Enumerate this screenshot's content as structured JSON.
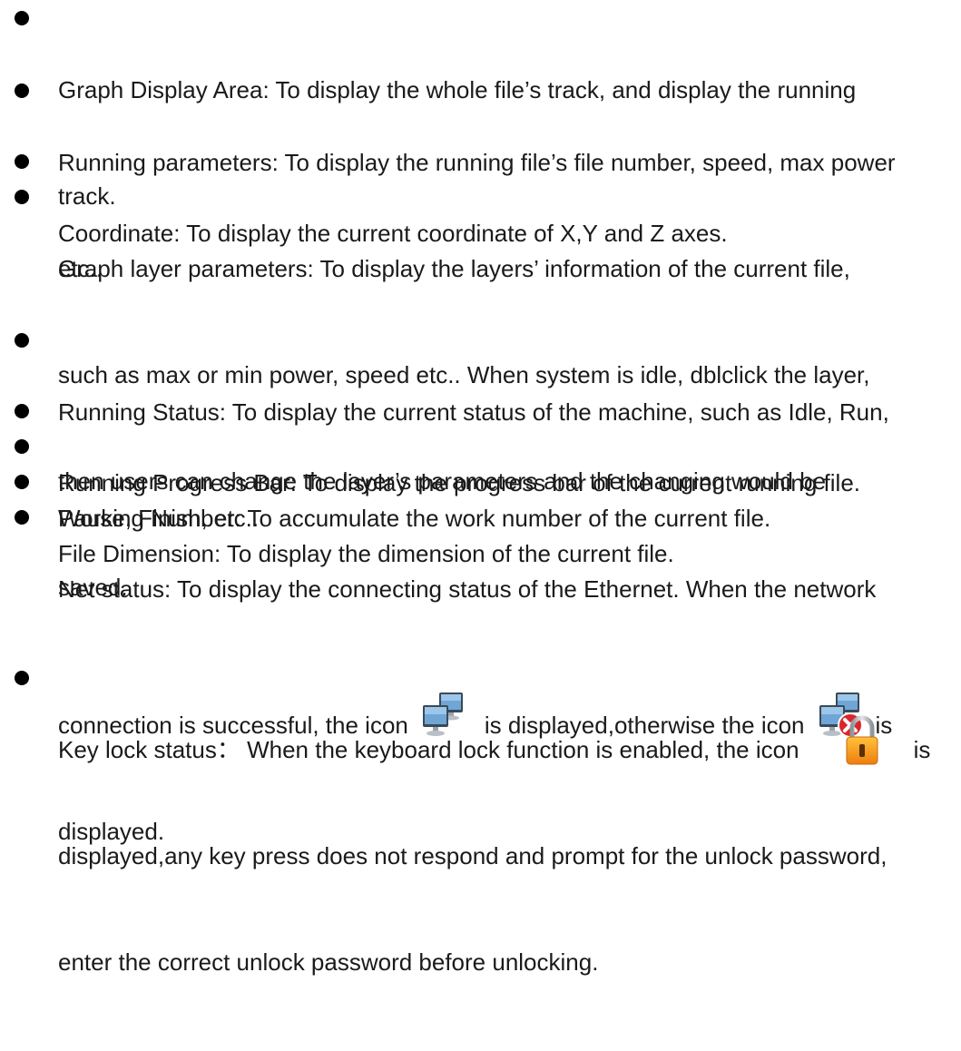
{
  "items": [
    {
      "lines": [
        "Graph Display Area: To display the whole file’s track, and display the running",
        "track."
      ]
    },
    {
      "lines": [
        "Running parameters: To display the running file’s file number, speed, max power",
        "etc.."
      ]
    },
    {
      "lines": [
        "Coordinate: To display the current coordinate of X,Y and Z axes."
      ]
    },
    {
      "lines": [
        "Graph layer parameters: To display the layers’ information of the current file,",
        "such as max or min power, speed etc.. When system is idle, dblclick the layer,",
        "then users can change the layer’s parameters and the changing would be",
        "saved."
      ]
    },
    {
      "lines": [
        "Running Status: To display the current status of the machine, such as Idle, Run,",
        "Pause, Finish, etc.."
      ]
    },
    {
      "lines": [
        "Running Progress Bar: To display the progress bar of the current running file."
      ]
    },
    {
      "lines": [
        "Working Number: To accumulate the work number of the current file."
      ]
    },
    {
      "lines": [
        "File Dimension: To display the dimension of the current file."
      ]
    },
    {
      "line1": "Net status: To display the connecting status of the Ethernet. When the network",
      "line2_a": "connection is successful, the icon",
      "line2_b": "is displayed,otherwise the icon",
      "line2_c": "is",
      "line3": "displayed."
    },
    {
      "line1_a": "Key lock status： When the keyboard lock function is enabled, the icon",
      "line1_b": "is",
      "line2": "displayed,any key press does not respond and prompt for the unlock password,",
      "line3": "enter the correct unlock password before unlocking."
    }
  ],
  "icons": {
    "net_ok": "network-connected-icon",
    "net_err": "network-disconnected-icon",
    "lock": "keyboard-lock-icon"
  },
  "colors": {
    "text": "#1a1a1a",
    "bullet": "#000000",
    "lock_body": "#f39a1a",
    "error_red": "#d8262c"
  }
}
